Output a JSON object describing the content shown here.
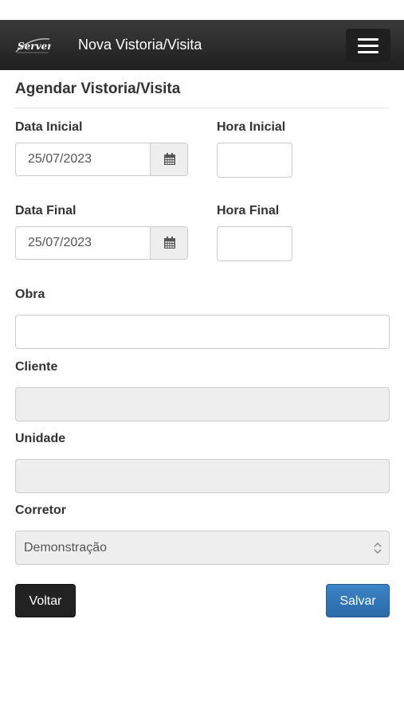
{
  "navbar": {
    "logo_text": "Server",
    "title": "Nova Vistoria/Visita",
    "menu_icon": "hamburger-menu-icon"
  },
  "form": {
    "legend": "Agendar Vistoria/Visita",
    "data_inicial": {
      "label": "Data Inicial",
      "value": "25/07/2023",
      "icon": "calendar-icon"
    },
    "hora_inicial": {
      "label": "Hora Inicial",
      "value": ""
    },
    "data_final": {
      "label": "Data Final",
      "value": "25/07/2023",
      "icon": "calendar-icon"
    },
    "hora_final": {
      "label": "Hora Final",
      "value": ""
    },
    "obra": {
      "label": "Obra",
      "value": ""
    },
    "cliente": {
      "label": "Cliente",
      "value": ""
    },
    "unidade": {
      "label": "Unidade",
      "value": ""
    },
    "corretor": {
      "label": "Corretor",
      "selected": "Demonstração",
      "icon": "select-arrows-icon"
    }
  },
  "buttons": {
    "back_label": "Voltar",
    "save_label": "Salvar"
  },
  "colors": {
    "navbar_bg": "#2b2b2b",
    "save_button": "#337ab7",
    "back_button": "#222222",
    "disabled_bg": "#eeeeee"
  }
}
